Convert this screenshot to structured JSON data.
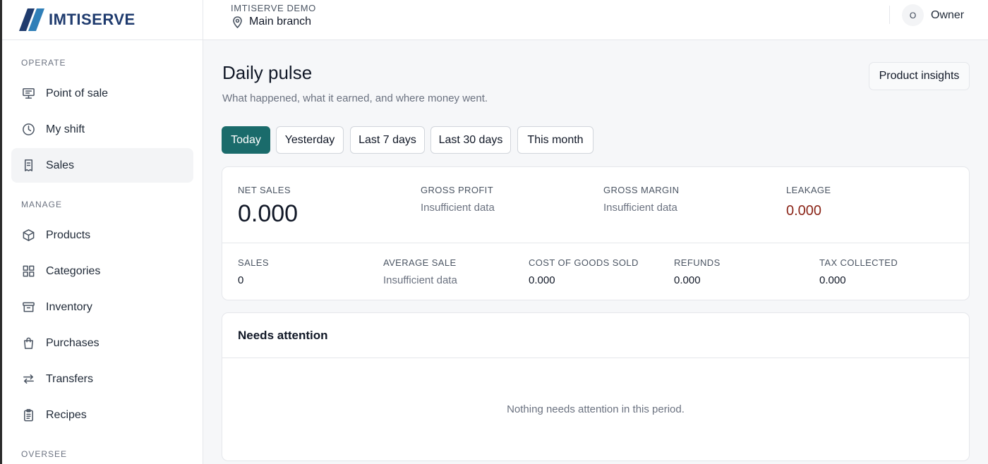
{
  "brand": {
    "name": "IMTISERVE",
    "color": "#1f3b6e",
    "logo_icon": "slanted-stripes-logo"
  },
  "header": {
    "org_name": "IMTISERVE DEMO",
    "branch_label": "Main branch",
    "branch_icon": "map-pin-icon",
    "user_initial": "O",
    "user_name": "Owner"
  },
  "sidebar": {
    "sections": [
      {
        "label": "OPERATE",
        "items": [
          {
            "label": "Point of sale",
            "icon": "monitor-icon"
          },
          {
            "label": "My shift",
            "icon": "clock-icon"
          },
          {
            "label": "Sales",
            "icon": "receipt-icon",
            "active": true
          }
        ]
      },
      {
        "label": "MANAGE",
        "items": [
          {
            "label": "Products",
            "icon": "box-icon"
          },
          {
            "label": "Categories",
            "icon": "grid-icon"
          },
          {
            "label": "Inventory",
            "icon": "archive-icon"
          },
          {
            "label": "Purchases",
            "icon": "shopping-bag-icon"
          },
          {
            "label": "Transfers",
            "icon": "arrows-swap-icon"
          },
          {
            "label": "Recipes",
            "icon": "clipboard-icon"
          }
        ]
      },
      {
        "label": "OVERSEE",
        "items": []
      }
    ]
  },
  "main": {
    "title": "Daily pulse",
    "subtitle": "What happened, what it earned, and where money went.",
    "insights_button": "Product insights",
    "ranges": [
      {
        "label": "Today",
        "active": true
      },
      {
        "label": "Yesterday"
      },
      {
        "label": "Last 7 days"
      },
      {
        "label": "Last 30 days"
      },
      {
        "label": "This month"
      }
    ],
    "kpi_top": {
      "net_sales": {
        "label": "NET SALES",
        "value": "0.000"
      },
      "gross_profit": {
        "label": "GROSS PROFIT",
        "value": "Insufficient data"
      },
      "gross_margin": {
        "label": "GROSS MARGIN",
        "value": "Insufficient data"
      },
      "leakage": {
        "label": "LEAKAGE",
        "value": "0.000"
      }
    },
    "kpi_bottom": {
      "sales": {
        "label": "SALES",
        "value": "0"
      },
      "average_sale": {
        "label": "AVERAGE SALE",
        "value": "Insufficient data"
      },
      "cogs": {
        "label": "COST OF GOODS SOLD",
        "value": "0.000"
      },
      "refunds": {
        "label": "REFUNDS",
        "value": "0.000"
      },
      "tax": {
        "label": "TAX COLLECTED",
        "value": "0.000"
      }
    },
    "attention": {
      "title": "Needs attention",
      "empty_message": "Nothing needs attention in this period."
    }
  },
  "colors": {
    "accent": "#1a6b6b",
    "leakage": "#8b2518",
    "muted_text": "#6b7280"
  }
}
